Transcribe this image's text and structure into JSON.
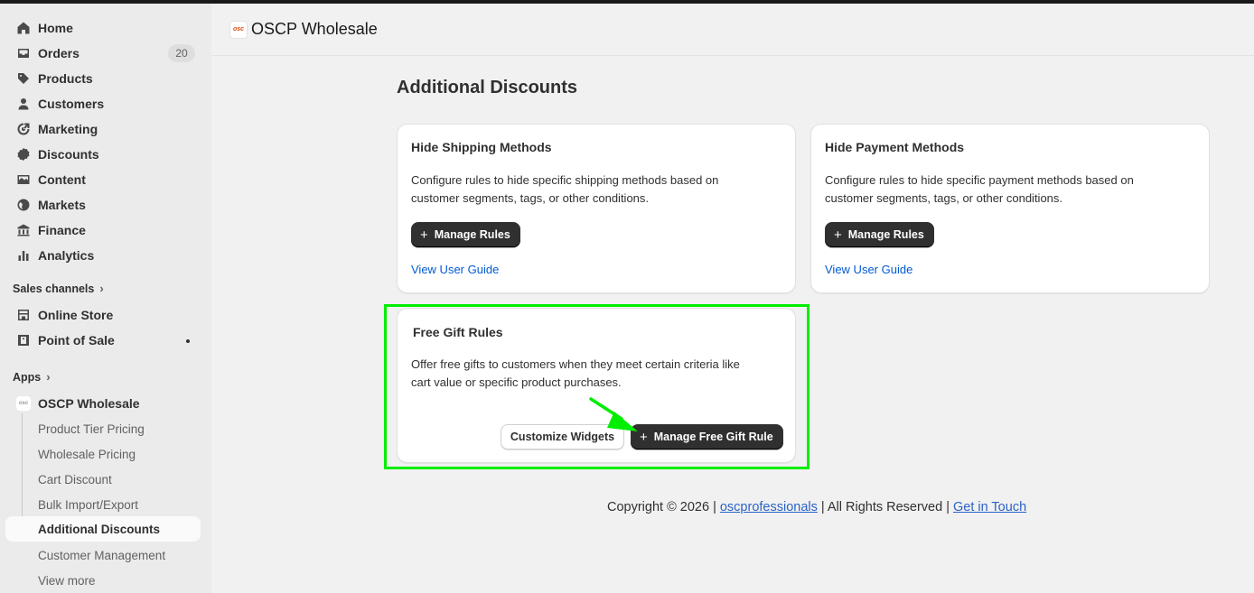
{
  "sidebar": {
    "main_items": [
      {
        "label": "Home",
        "icon": "home-icon"
      },
      {
        "label": "Orders",
        "icon": "orders-icon",
        "badge": "20"
      },
      {
        "label": "Products",
        "icon": "tag-icon"
      },
      {
        "label": "Customers",
        "icon": "person-icon"
      },
      {
        "label": "Marketing",
        "icon": "target-icon"
      },
      {
        "label": "Discounts",
        "icon": "discount-icon"
      },
      {
        "label": "Content",
        "icon": "content-icon"
      },
      {
        "label": "Markets",
        "icon": "globe-icon"
      },
      {
        "label": "Finance",
        "icon": "bank-icon"
      },
      {
        "label": "Analytics",
        "icon": "bar-chart-icon"
      }
    ],
    "sales_channels_label": "Sales channels",
    "channels": [
      {
        "label": "Online Store",
        "icon": "store-icon"
      },
      {
        "label": "Point of Sale",
        "icon": "pos-icon"
      }
    ],
    "apps_label": "Apps",
    "app": {
      "label": "OSCP Wholesale",
      "icon": "oscp-app-icon"
    },
    "app_subitems": [
      {
        "label": "Product Tier Pricing"
      },
      {
        "label": "Wholesale Pricing"
      },
      {
        "label": "Cart Discount"
      },
      {
        "label": "Bulk Import/Export"
      },
      {
        "label": "Additional Discounts",
        "active": true
      },
      {
        "label": "Customer Management"
      },
      {
        "label": "View more"
      }
    ]
  },
  "header": {
    "title": "OSCP Wholesale",
    "logo_text": "osc"
  },
  "page": {
    "title": "Additional Discounts"
  },
  "cards": {
    "shipping": {
      "title": "Hide Shipping Methods",
      "desc_line1": "Configure rules to hide specific shipping methods based on",
      "desc_line2": "customer segments, tags, or other conditions.",
      "button": "Manage Rules",
      "link": "View User Guide"
    },
    "payment": {
      "title": "Hide Payment Methods",
      "desc_line1": "Configure rules to hide specific payment methods based on",
      "desc_line2": "customer segments, tags, or other conditions.",
      "button": "Manage Rules",
      "link": "View User Guide"
    },
    "free_gift": {
      "title": "Free Gift Rules",
      "desc_line1": "Offer free gifts to customers when they meet certain criteria like",
      "desc_line2": "cart value or specific product purchases.",
      "secondary_button": "Customize Widgets",
      "primary_button": "Manage Free Gift Rule"
    }
  },
  "footer": {
    "copyright": "Copyright © 2026 |",
    "company_link": "oscprofessionals",
    "rights": "| All Rights Reserved |",
    "contact_link": "Get in Touch"
  },
  "colors": {
    "highlight": "#00ee00",
    "link": "#005bd3",
    "primary_button": "#303030"
  }
}
